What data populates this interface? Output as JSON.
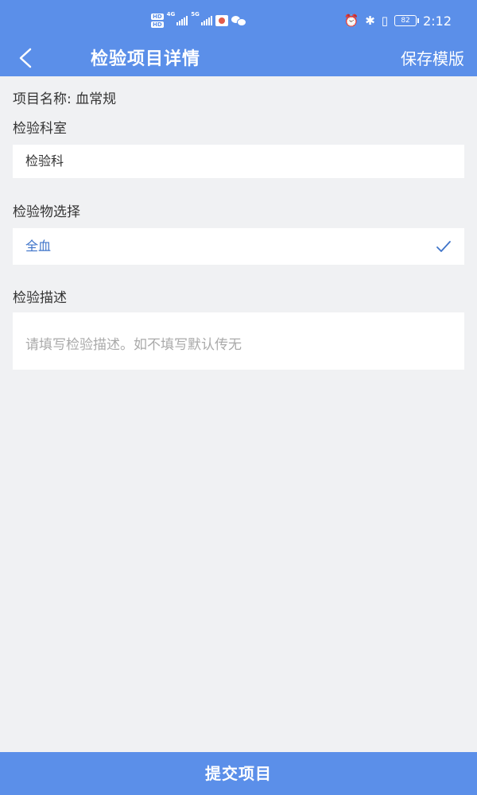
{
  "status_bar": {
    "hd_top": "HD",
    "hd_bottom": "HD",
    "net_1": "4G",
    "net_2": "5G",
    "battery": "82",
    "time": "2:12"
  },
  "header": {
    "back_icon": "chevron-left-icon",
    "title": "检验项目详情",
    "save_template_label": "保存模版"
  },
  "form": {
    "project_name": "项目名称: 血常规",
    "department_label": "检验科室",
    "department_value": "检验科",
    "specimen_label": "检验物选择",
    "specimen_value": "全血",
    "description_label": "检验描述",
    "description_placeholder": "请填写检验描述。如不填写默认传无",
    "description_value": ""
  },
  "footer": {
    "submit_label": "提交项目"
  },
  "colors": {
    "primary": "#5b8fe9",
    "background": "#f0f1f3",
    "selected_text": "#3f74c9"
  }
}
